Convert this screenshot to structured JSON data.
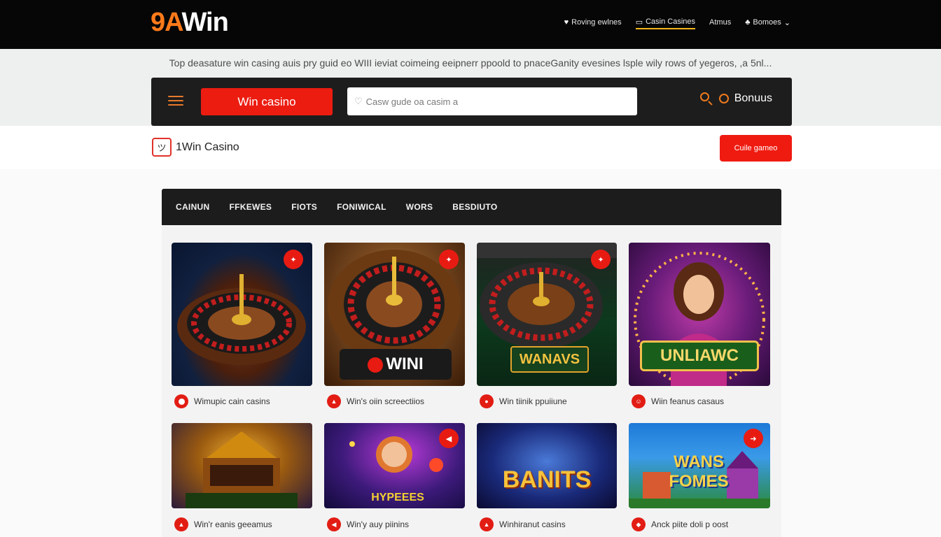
{
  "header": {
    "logo_part1": "9A",
    "logo_part2": "Win",
    "nav": [
      {
        "label": "Roving ewlnes",
        "icon": "heart-icon"
      },
      {
        "label": "Casin Casines",
        "icon": "card-icon",
        "active": true
      },
      {
        "label": "Atmus",
        "icon": ""
      },
      {
        "label": "Bomoes",
        "icon": "bonus-icon"
      }
    ]
  },
  "tagline": "Top deasature win casing auis pry guid eo  WIII ieviat coimeing eeipnerr ppoold to pnaceGanity evesines lsple wily rows of yegeros, ,a 5nl...",
  "searchbar": {
    "button_label": "Win casino",
    "search_placeholder": "Casw gude oa casim a",
    "bonus_label": "Bonuus"
  },
  "brand": {
    "name": "1Win Casino",
    "cta_label": "Cuile gameo"
  },
  "tabs": [
    "CAINUN",
    "FFKEWES",
    "FIOTS",
    "FONIWICAL",
    "WORS",
    "BESDIUTO"
  ],
  "games": [
    {
      "caption": "Wimupic cain casins",
      "thumb_text": "",
      "theme": "roulette-blue"
    },
    {
      "caption": "Win's oiin screectiios",
      "thumb_text": "WINI",
      "theme": "roulette-gold"
    },
    {
      "caption": "Win tiinik ppuiiune",
      "thumb_text": "WANAVS",
      "theme": "roulette-green"
    },
    {
      "caption": "Wiin feanus casaus",
      "thumb_text": "UNLIAWC",
      "theme": "lady-purple"
    },
    {
      "caption": "Win'r eanis geeamus",
      "thumb_text": "",
      "theme": "temple-gold"
    },
    {
      "caption": "Win'y auy piinins",
      "thumb_text": "HYPEEES",
      "theme": "hero-purple"
    },
    {
      "caption": "Winhiranut casins",
      "thumb_text": "BANITS",
      "theme": "cosmic-blue"
    },
    {
      "caption": "Anck piite doli p oost",
      "thumb_text": "WANS FOMES",
      "theme": "town-teal"
    }
  ]
}
